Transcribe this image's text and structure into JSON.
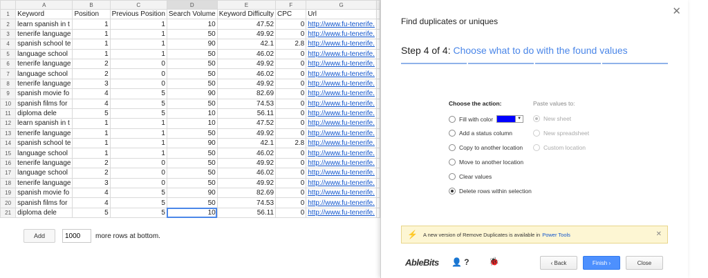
{
  "sheet": {
    "col_letters": [
      "A",
      "B",
      "C",
      "D",
      "E",
      "F",
      "G"
    ],
    "headers": [
      "Keyword",
      "Position",
      "Previous Position",
      "Search Volume",
      "Keyword Difficulty",
      "CPC",
      "Url"
    ],
    "rows": [
      [
        "learn spanish in t",
        "1",
        "1",
        "10",
        "47.52",
        "0",
        "http://www.fu-tenerife."
      ],
      [
        "tenerife language",
        "1",
        "1",
        "50",
        "49.92",
        "0",
        "http://www.fu-tenerife."
      ],
      [
        "spanish school te",
        "1",
        "1",
        "90",
        "42.1",
        "2.8",
        "http://www.fu-tenerife."
      ],
      [
        "language school",
        "1",
        "1",
        "50",
        "46.02",
        "0",
        "http://www.fu-tenerife."
      ],
      [
        "tenerife language",
        "2",
        "0",
        "50",
        "49.92",
        "0",
        "http://www.fu-tenerife."
      ],
      [
        "language school",
        "2",
        "0",
        "50",
        "46.02",
        "0",
        "http://www.fu-tenerife."
      ],
      [
        "tenerife language",
        "3",
        "0",
        "50",
        "49.92",
        "0",
        "http://www.fu-tenerife."
      ],
      [
        "spanish movie fo",
        "4",
        "5",
        "90",
        "82.69",
        "0",
        "http://www.fu-tenerife."
      ],
      [
        "spanish films for",
        "4",
        "5",
        "50",
        "74.53",
        "0",
        "http://www.fu-tenerife."
      ],
      [
        "diploma dele",
        "5",
        "5",
        "10",
        "56.11",
        "0",
        "http://www.fu-tenerife."
      ],
      [
        "learn spanish in t",
        "1",
        "1",
        "10",
        "47.52",
        "0",
        "http://www.fu-tenerife."
      ],
      [
        "tenerife language",
        "1",
        "1",
        "50",
        "49.92",
        "0",
        "http://www.fu-tenerife."
      ],
      [
        "spanish school te",
        "1",
        "1",
        "90",
        "42.1",
        "2.8",
        "http://www.fu-tenerife."
      ],
      [
        "language school",
        "1",
        "1",
        "50",
        "46.02",
        "0",
        "http://www.fu-tenerife."
      ],
      [
        "tenerife language",
        "2",
        "0",
        "50",
        "49.92",
        "0",
        "http://www.fu-tenerife."
      ],
      [
        "language school",
        "2",
        "0",
        "50",
        "46.02",
        "0",
        "http://www.fu-tenerife."
      ],
      [
        "tenerife language",
        "3",
        "0",
        "50",
        "49.92",
        "0",
        "http://www.fu-tenerife."
      ],
      [
        "spanish movie fo",
        "4",
        "5",
        "90",
        "82.69",
        "0",
        "http://www.fu-tenerife."
      ],
      [
        "spanish films for",
        "4",
        "5",
        "50",
        "74.53",
        "0",
        "http://www.fu-tenerife."
      ],
      [
        "diploma dele",
        "5",
        "5",
        "10",
        "56.11",
        "0",
        "http://www.fu-tenerife."
      ]
    ],
    "add_label": "Add",
    "add_rows_value": "1000",
    "add_rows_suffix": "more rows at bottom."
  },
  "dialog": {
    "title": "Find duplicates or uniques",
    "step_prefix": "Step 4 of 4:",
    "step_desc": "Choose what to do with the found values",
    "choose_label": "Choose the action:",
    "paste_label": "Paste values to:",
    "actions": [
      {
        "label": "Fill with color",
        "checked": false
      },
      {
        "label": "Add a status column",
        "checked": false
      },
      {
        "label": "Copy to another location",
        "checked": false
      },
      {
        "label": "Move to another location",
        "checked": false
      },
      {
        "label": "Clear values",
        "checked": false
      },
      {
        "label": "Delete rows within selection",
        "checked": true
      }
    ],
    "paste_options": [
      {
        "label": "New sheet",
        "checked": true
      },
      {
        "label": "New spreadsheet",
        "checked": false
      },
      {
        "label": "Custom location",
        "checked": false
      }
    ],
    "fill_color": "#0000ff",
    "notice_text": "A new version of Remove Duplicates is available in",
    "notice_link": "Power Tools",
    "brand": "AbleBits",
    "help_text": "?",
    "back_label": "‹ Back",
    "finish_label": "Finish ›",
    "close_label": "Close"
  }
}
